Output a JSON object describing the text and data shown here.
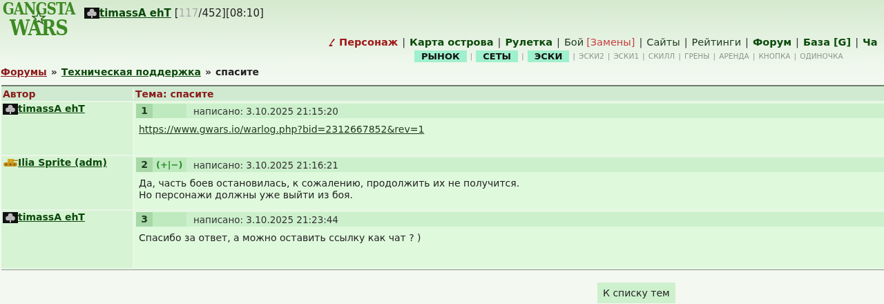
{
  "logo": {
    "top": "GANGSTA",
    "bottom": "WARS"
  },
  "header": {
    "user": "timassA ehT",
    "stats": [
      {
        "text": "[",
        "kind": "plain"
      },
      {
        "text": "117",
        "kind": "dim"
      },
      {
        "text": "/452][08:10]",
        "kind": "plain"
      }
    ]
  },
  "nav_separator": "|",
  "nav": [
    {
      "label": "Персонаж",
      "kind": "accent"
    },
    {
      "label": "Карта острова",
      "kind": "bold"
    },
    {
      "label": "Рулетка",
      "kind": "bold"
    },
    {
      "label": "Бой",
      "kind": "plain"
    },
    {
      "label": "[Замены]",
      "kind": "red"
    },
    {
      "label": "Сайты",
      "kind": "plain"
    },
    {
      "label": "Рейтинги",
      "kind": "plain"
    },
    {
      "label": "Форум",
      "kind": "bold"
    },
    {
      "label": "База [G]",
      "kind": "bold"
    },
    {
      "label": "Ча",
      "kind": "bold"
    }
  ],
  "subnav": [
    {
      "label": "РЫНОК",
      "kind": "tag"
    },
    {
      "label": "СЕТЫ",
      "kind": "tag"
    },
    {
      "label": "ЭСКИ",
      "kind": "tag"
    },
    {
      "label": "ЭСКИ2",
      "kind": "small"
    },
    {
      "label": "ЭСКИ1",
      "kind": "small"
    },
    {
      "label": "СКИЛЛ",
      "kind": "small"
    },
    {
      "label": "ГРЕНЫ",
      "kind": "small"
    },
    {
      "label": "АРЕНДА",
      "kind": "small"
    },
    {
      "label": "КНОПКА",
      "kind": "small"
    },
    {
      "label": "ОДИНОЧКА",
      "kind": "small"
    }
  ],
  "breadcrumb_separator": "»",
  "breadcrumb": [
    {
      "label": "Форумы",
      "kind": "root"
    },
    {
      "label": "Техническая поддержка",
      "kind": "link"
    },
    {
      "label": "спасите",
      "kind": "current"
    }
  ],
  "table": {
    "author_heading": "Автор",
    "topic_heading": "Тема: спасите",
    "posts": [
      {
        "author": "timassA ehT",
        "avatar": {
          "kind": "club"
        },
        "number": "1",
        "date": "написано: 3.10.2025 21:15:20",
        "body": [
          {
            "text": "https://www.gwars.io/warlog.php?bid=2312667852&rev=1",
            "kind": "link"
          }
        ]
      },
      {
        "author": "Ilia Sprite (adm)",
        "avatar": {
          "kind": "tank"
        },
        "number": "2",
        "vote": "(+|−)",
        "date": "написано: 3.10.2025 21:16:21",
        "body": [
          {
            "text": "Да, часть боев остановилась, к сожалению, продолжить их не получится.",
            "kind": "text"
          },
          {
            "text": "Но персонажи должны уже выйти из боя.",
            "kind": "text"
          }
        ]
      },
      {
        "author": "timassA ehT",
        "avatar": {
          "kind": "club"
        },
        "number": "3",
        "date": "написано: 3.10.2025 21:23:44",
        "body": [
          {
            "text": "Спасибо за ответ, а можно оставить ссылку как чат ? )",
            "kind": "text"
          }
        ]
      }
    ]
  },
  "back_button": "К списку тем"
}
